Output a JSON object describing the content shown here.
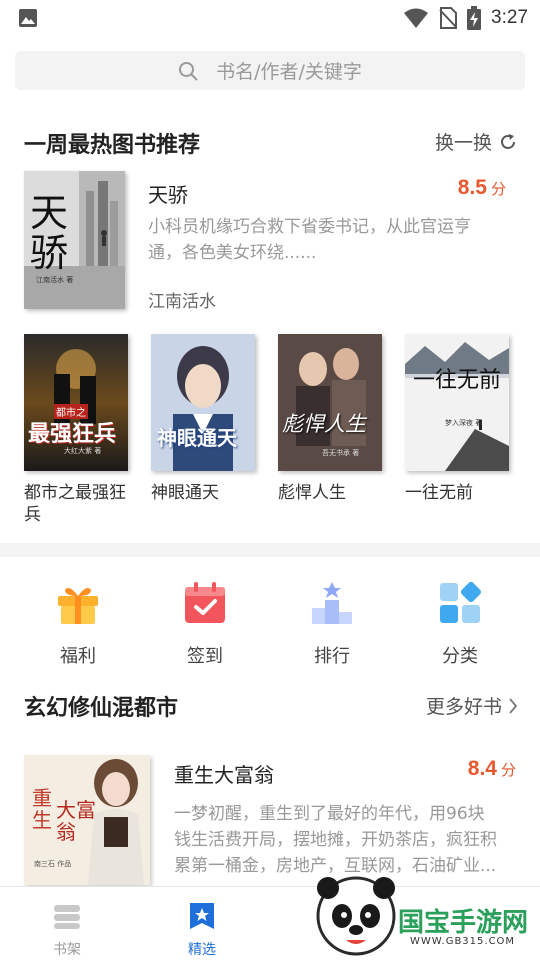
{
  "status_bar": {
    "time": "3:27"
  },
  "search": {
    "placeholder": "书名/作者/关键字"
  },
  "weekly": {
    "title": "一周最热图书推荐",
    "action": "换一换",
    "featured": {
      "title": "天骄",
      "score": "8.5",
      "score_unit": "分",
      "desc_line1": "小科员机缘巧合救下省委书记，从此官运亨",
      "desc_line2": "通，各色美女环绕......",
      "author": "江南活水",
      "cover_text": "天骄",
      "cover_sub": "江南活水 著"
    },
    "books": [
      {
        "name": "都市之最强狂兵",
        "cover_text": "最强狂兵",
        "cover_top": "都市之",
        "cover_sub": "大红大紫 著"
      },
      {
        "name": "神眼通天",
        "cover_text": "神眼通天"
      },
      {
        "name": "彪悍人生",
        "cover_text": "彪悍人生",
        "cover_sub": "吾无书承 著"
      },
      {
        "name": "一往无前",
        "cover_text": "一往无前",
        "cover_sub": "梦入深夜 著"
      }
    ]
  },
  "quick_actions": [
    {
      "label": "福利",
      "icon": "gift-icon"
    },
    {
      "label": "签到",
      "icon": "calendar-check-icon"
    },
    {
      "label": "排行",
      "icon": "podium-icon"
    },
    {
      "label": "分类",
      "icon": "grid-icon"
    }
  ],
  "section2": {
    "title": "玄幻修仙混都市",
    "action": "更多好书",
    "book": {
      "title": "重生大富翁",
      "score": "8.4",
      "score_unit": "分",
      "desc_line1": "一梦初醒，重生到了最好的年代，用96块",
      "desc_line2": "钱生活费开局，摆地摊，开奶茶店，疯狂积",
      "desc_line3": "累第一桶金，房地产，互联网，石油矿业...",
      "cover_text1": "重生",
      "cover_text2": "大富翁",
      "cover_sub": "南三石 作品"
    }
  },
  "bottom_nav": [
    {
      "label": "书架",
      "icon": "bookshelf-icon"
    },
    {
      "label": "精选",
      "icon": "featured-star-icon"
    }
  ],
  "watermark": {
    "brand": "国宝手游网",
    "url": "WWW.GB315.COM"
  },
  "colors": {
    "accent": "#1e6fd9",
    "score": "#e8582e",
    "divider": "#f3f3f3"
  }
}
